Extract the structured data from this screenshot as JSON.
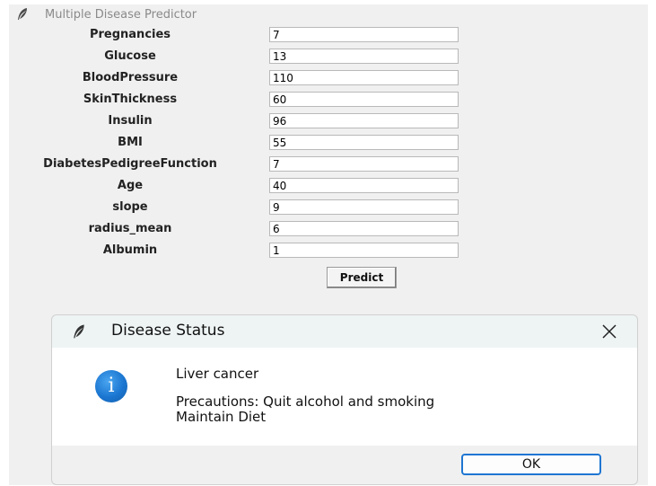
{
  "window": {
    "title": "Multiple Disease Predictor"
  },
  "form": {
    "fields": [
      {
        "label": "Pregnancies",
        "value": "7"
      },
      {
        "label": "Glucose",
        "value": "13"
      },
      {
        "label": "BloodPressure",
        "value": "110"
      },
      {
        "label": "SkinThickness",
        "value": "60"
      },
      {
        "label": "Insulin",
        "value": "96"
      },
      {
        "label": "BMI",
        "value": "55"
      },
      {
        "label": "DiabetesPedigreeFunction",
        "value": "7"
      },
      {
        "label": "Age",
        "value": "40"
      },
      {
        "label": "slope",
        "value": "9"
      },
      {
        "label": "radius_mean",
        "value": "6"
      },
      {
        "label": "Albumin",
        "value": "1"
      }
    ],
    "predict_label": "Predict"
  },
  "dialog": {
    "title": "Disease Status",
    "message_line1": "Liver cancer",
    "message_line2": "Precautions: Quit alcohol and smoking",
    "message_line3": "Maintain Diet",
    "ok_label": "OK",
    "info_glyph": "i",
    "icon": "info-icon"
  }
}
